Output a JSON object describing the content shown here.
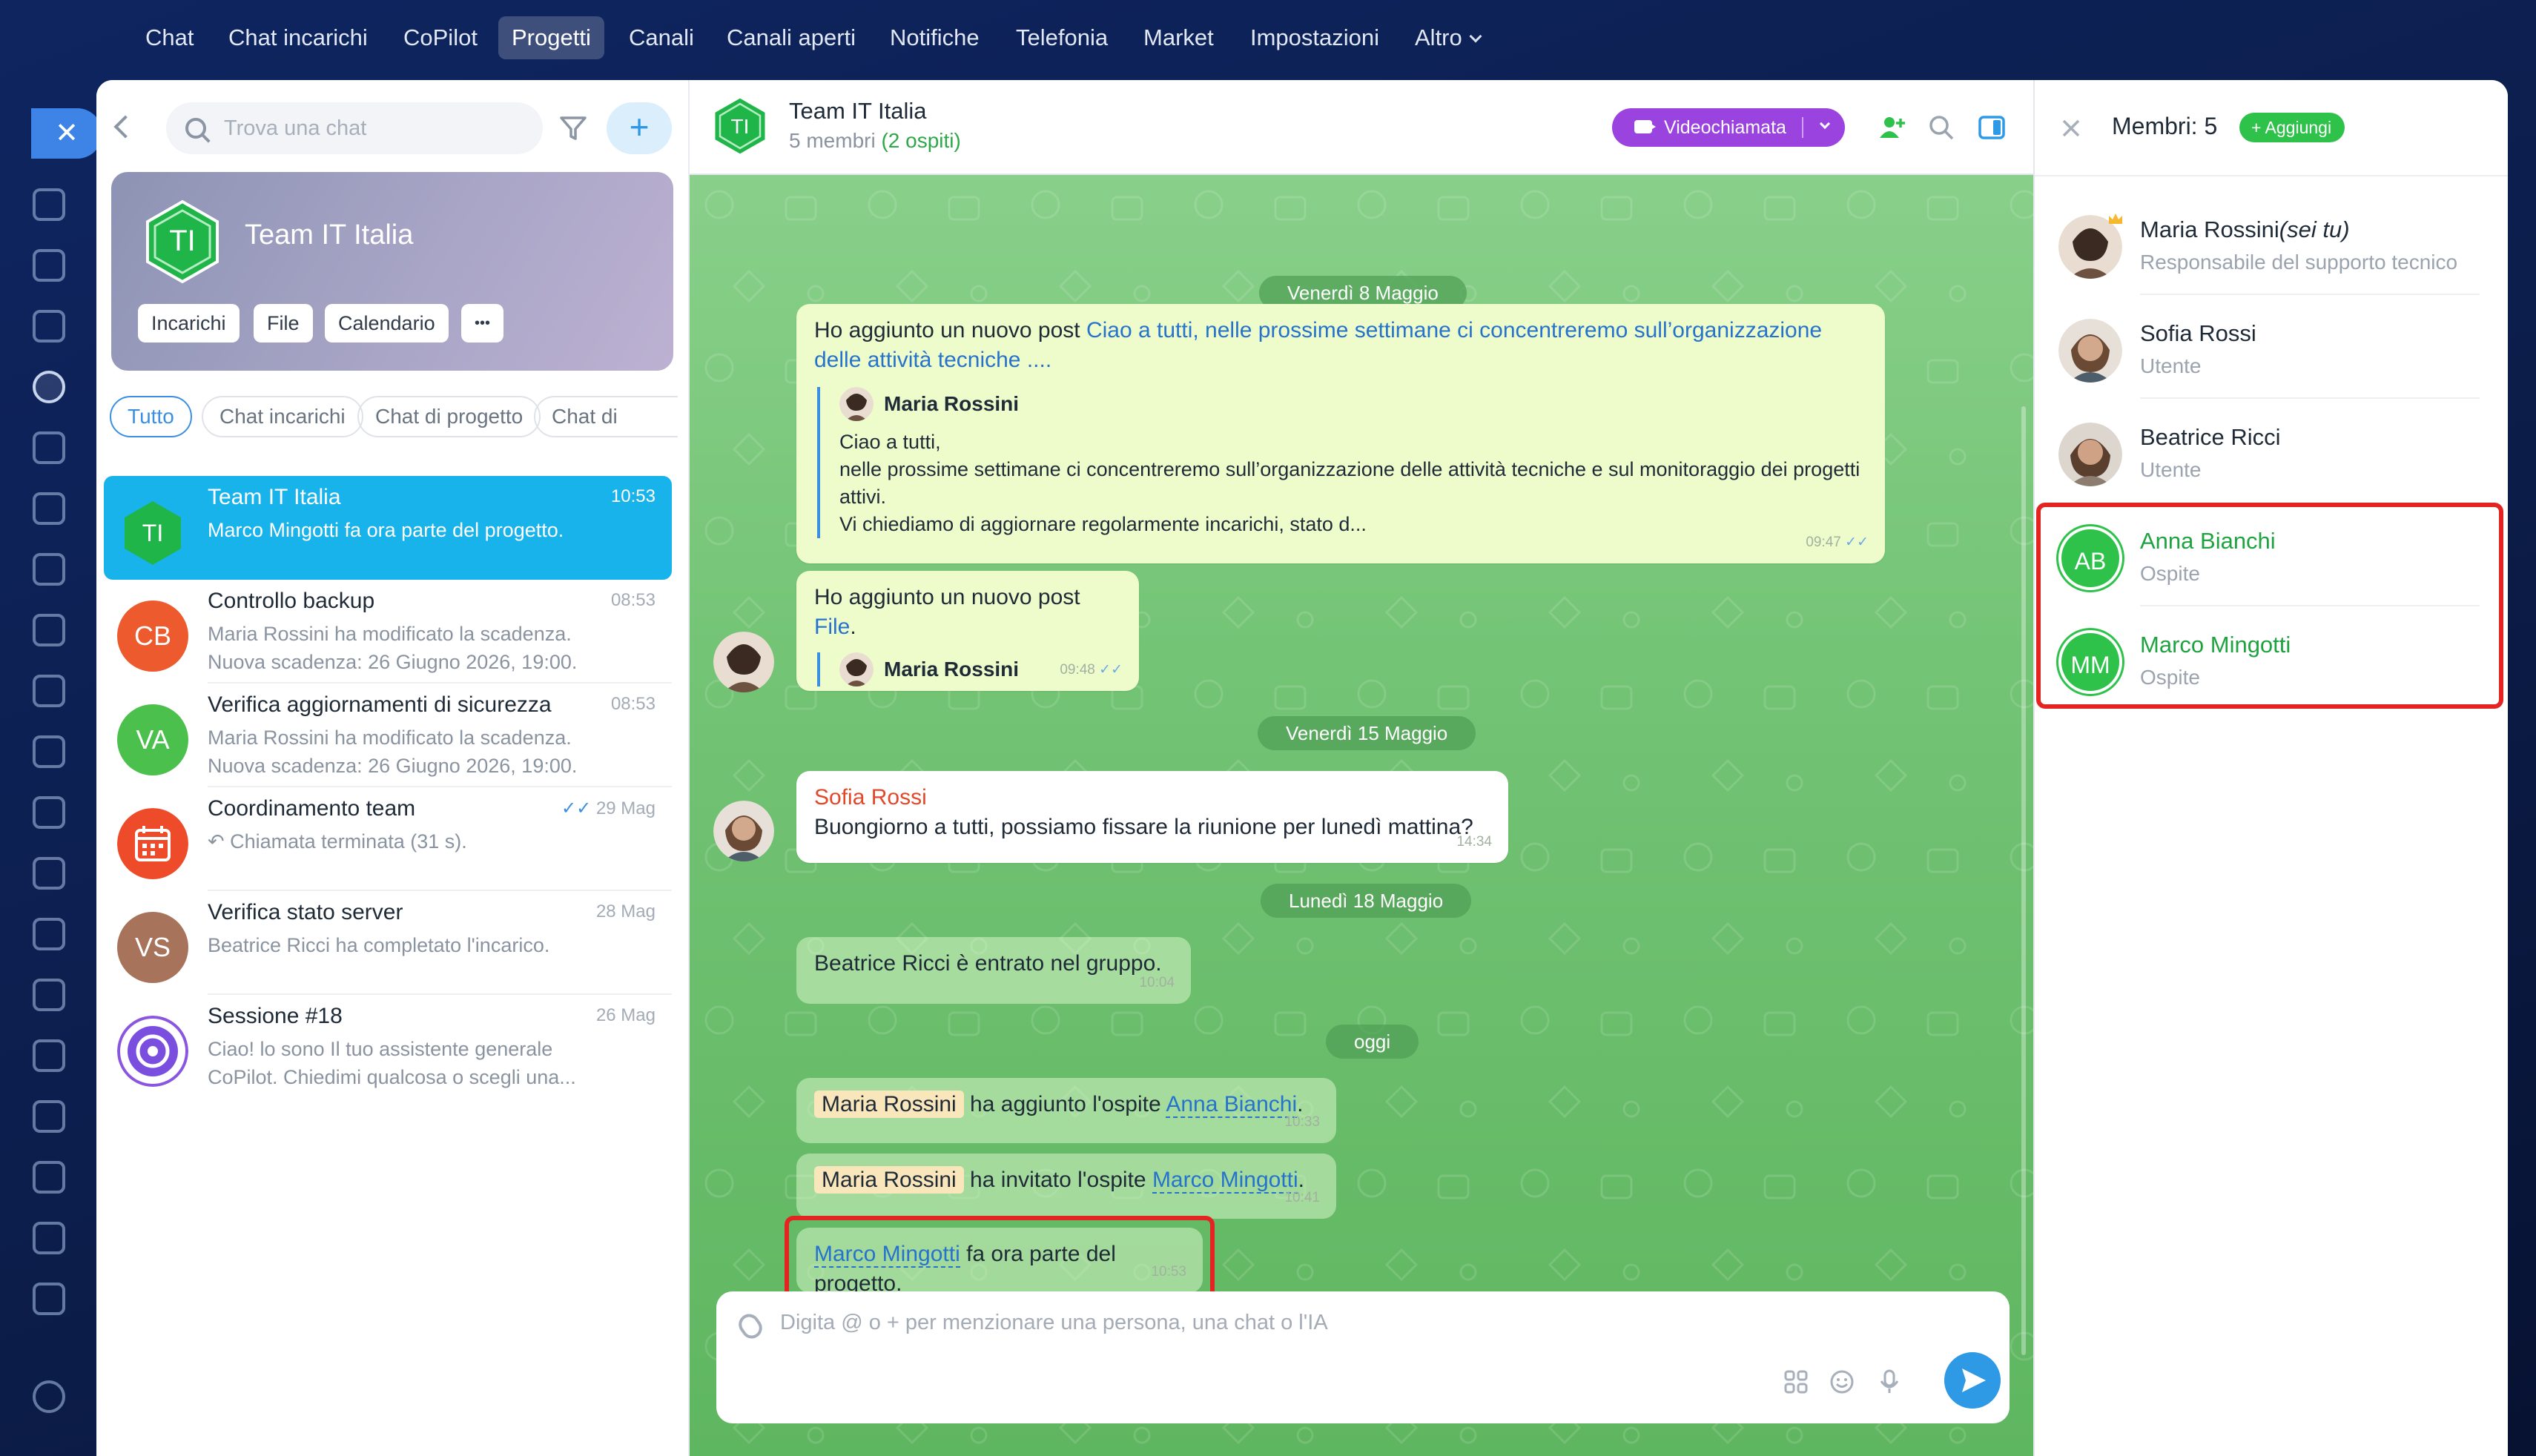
{
  "topnav": {
    "items": [
      "Chat",
      "Chat incarichi",
      "CoPilot",
      "Progetti",
      "Canali",
      "Canali aperti",
      "Notifiche",
      "Telefonia",
      "Market",
      "Impostazioni",
      "Altro"
    ],
    "active": "Progetti"
  },
  "sidebar": {
    "search_placeholder": "Trova una chat",
    "new_button": "+",
    "hero": {
      "initials": "TI",
      "title": "Team IT Italia",
      "chips": [
        "Incarichi",
        "File",
        "Calendario",
        "•••"
      ]
    },
    "filters": [
      "Tutto",
      "Chat incarichi",
      "Chat di progetto",
      "Chat di"
    ],
    "chats": [
      {
        "initials": "TI",
        "name": "Team IT Italia",
        "time": "10:53",
        "preview": "Marco Mingotti fa ora parte del progetto.",
        "active": true
      },
      {
        "initials": "CB",
        "name": "Controllo backup",
        "time": "08:53",
        "preview": "Maria Rossini ha modificato la scadenza. Nuova scadenza: 26 Giugno 2026, 19:00."
      },
      {
        "initials": "VA",
        "name": "Verifica aggiornamenti di sicurezza",
        "time": "08:53",
        "preview": "Maria Rossini ha modificato la scadenza. Nuova scadenza: 26 Giugno 2026, 19:00."
      },
      {
        "initials": "",
        "name": "Coordinamento team",
        "time": "29 Mag",
        "preview": "Chiamata terminata (31 s)."
      },
      {
        "initials": "VS",
        "name": "Verifica stato server",
        "time": "28 Mag",
        "preview": "Beatrice Ricci ha completato l'incarico."
      },
      {
        "initials": "",
        "name": "Sessione #18",
        "time": "26 Mag",
        "preview": "Ciao! lo sono Il tuo assistente generale CoPilot. Chiedimi qualcosa o scegli una..."
      }
    ]
  },
  "chat": {
    "initials": "TI",
    "name": "Team IT Italia",
    "members_count": "5 membri",
    "guests": "(2 ospiti)",
    "video_label": "Videochiamata",
    "dates": [
      "Venerdì 8 Maggio",
      "Venerdì 15 Maggio",
      "Lunedì 18 Maggio",
      "oggi"
    ],
    "messages": {
      "m1_prefix": "Ho aggiunto un nuovo post ",
      "m1_link": "Ciao a tutti, nelle prossime settimane ci concentreremo sull’organizzazione delle attività tecniche ....",
      "m1_quote_author": "Maria Rossini",
      "m1_quote_l1": "Ciao a tutti,",
      "m1_quote_l2": "nelle prossime settimane ci concentreremo sull’organizzazione delle attività tecniche e sul monitoraggio dei progetti attivi.",
      "m1_quote_l3": "Vi chiediamo di aggiornare regolarmente incarichi, stato d...",
      "m1_time": "09:47",
      "m2_prefix": "Ho aggiunto un nuovo post ",
      "m2_link": "File",
      "m2_suffix": ".",
      "m2_quote_author": "Maria Rossini",
      "m2_time": "09:48",
      "m3_author": "Sofia Rossi",
      "m3_text": "Buongiorno a tutti, possiamo fissare la riunione per lunedì mattina?",
      "m3_time": "14:34",
      "m4_text": "Beatrice Ricci è entrato nel gruppo.",
      "m4_time": "10:04",
      "m5_tag": "Maria Rossini",
      "m5_text": " ha aggiunto l'ospite ",
      "m5_link": "Anna Bianchi",
      "m5_suffix": ".",
      "m5_time": "10:33",
      "m6_tag": "Maria Rossini",
      "m6_text": " ha invitato l'ospite ",
      "m6_link": "Marco Mingotti",
      "m6_suffix": ".",
      "m6_time": "10:41",
      "m7_link": "Marco Mingotti",
      "m7_text": " fa ora parte del progetto.",
      "m7_time": "10:53"
    },
    "composer_placeholder": "Digita @ o + per menzionare una persona, una chat o l'IA"
  },
  "members": {
    "title": "Membri: 5",
    "add_label": "+ Aggiungi",
    "list": [
      {
        "name": "Maria Rossini",
        "suffix": "(sei tu)",
        "role": "Responsabile del supporto tecnico"
      },
      {
        "name": "Sofia Rossi",
        "role": "Utente"
      },
      {
        "name": "Beatrice Ricci",
        "role": "Utente"
      },
      {
        "initials": "AB",
        "name": "Anna Bianchi",
        "role": "Ospite"
      },
      {
        "initials": "MM",
        "name": "Marco Mingotti",
        "role": "Ospite"
      }
    ]
  },
  "colors": {
    "accent": "#18b3ea",
    "guest_green": "#2fc24b",
    "video": "#9b43de",
    "highlight": "#e42420"
  }
}
